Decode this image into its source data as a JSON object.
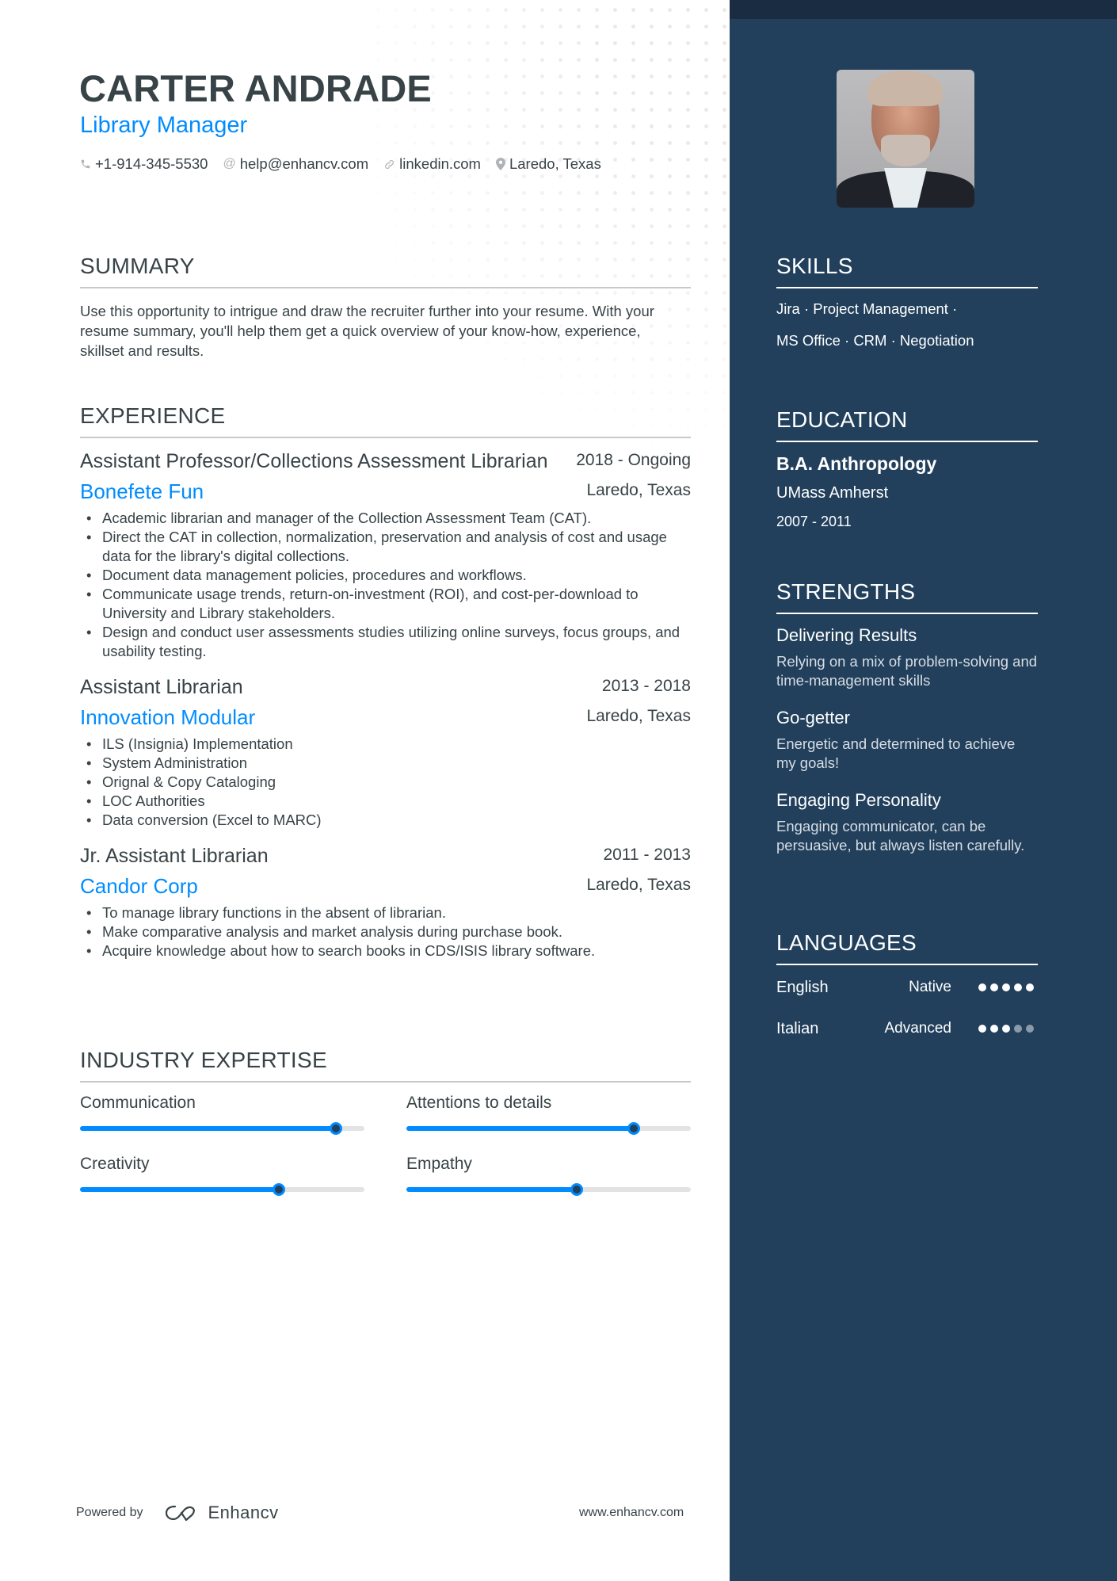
{
  "header": {
    "name": "CARTER ANDRADE",
    "role": "Library Manager",
    "contacts": [
      {
        "icon": "phone-icon",
        "text": "+1-914-345-5530"
      },
      {
        "icon": "at-icon",
        "text": "help@enhancv.com"
      },
      {
        "icon": "link-icon",
        "text": "linkedin.com"
      },
      {
        "icon": "location-pin-icon",
        "text": "Laredo, Texas"
      }
    ]
  },
  "summary": {
    "title": "SUMMARY",
    "text": "Use this opportunity to intrigue and draw the recruiter further into your resume. With your resume summary, you'll help them get a quick overview of your know-how, experience, skillset and results."
  },
  "experience": {
    "title": "EXPERIENCE",
    "jobs": [
      {
        "title": "Assistant Professor/Collections Assessment Librarian",
        "dates": "2018 - Ongoing",
        "company": "Bonefete Fun",
        "location": "Laredo, Texas",
        "bullets": [
          "Academic librarian and manager of the Collection Assessment Team (CAT).",
          "Direct the CAT in collection, normalization, preservation and analysis of cost and usage data for the library's digital collections.",
          "Document data management policies, procedures and workflows.",
          "Communicate usage trends, return-on-investment (ROI), and cost-per-download to University and Library stakeholders.",
          "Design and conduct user assessments studies utilizing online surveys, focus groups, and usability testing."
        ]
      },
      {
        "title": "Assistant Librarian",
        "dates": "2013 - 2018",
        "company": "Innovation Modular",
        "location": "Laredo, Texas",
        "bullets": [
          "ILS (Insignia) Implementation",
          "System Administration",
          "Orignal & Copy Cataloging",
          "LOC Authorities",
          "Data conversion (Excel to MARC)"
        ]
      },
      {
        "title": "Jr. Assistant Librarian",
        "dates": "2011 - 2013",
        "company": "Candor Corp",
        "location": "Laredo, Texas",
        "bullets": [
          "To manage  library functions in the absent of librarian.",
          "Make comparative analysis and market analysis during purchase book.",
          "Acquire knowledge about how to search books in CDS/ISIS library software."
        ]
      }
    ]
  },
  "industry_expertise": {
    "title": "INDUSTRY EXPERTISE",
    "items": [
      {
        "label": "Communication",
        "level_percent": 90
      },
      {
        "label": "Attentions to details",
        "level_percent": 80
      },
      {
        "label": "Creativity",
        "level_percent": 70
      },
      {
        "label": "Empathy",
        "level_percent": 60
      }
    ]
  },
  "footer": {
    "powered_by": "Powered by",
    "brand": "Enhancv",
    "website": "www.enhancv.com"
  },
  "sidebar": {
    "photo_alt": "Profile photo",
    "skills": {
      "title": "SKILLS",
      "lines": [
        "Jira · Project Management ·",
        "MS Office · CRM · Negotiation"
      ]
    },
    "education": {
      "title": "EDUCATION",
      "degree": "B.A. Anthropology",
      "school": "UMass Amherst",
      "years": "2007 - 2011"
    },
    "strengths": {
      "title": "STRENGTHS",
      "items": [
        {
          "title": "Delivering Results",
          "desc": "Relying on a mix of problem-solving and time-management skills"
        },
        {
          "title": "Go-getter",
          "desc": "Energetic and determined to achieve my goals!"
        },
        {
          "title": "Engaging Personality",
          "desc": "Engaging communicator, can be persuasive, but always listen carefully."
        }
      ]
    },
    "languages": {
      "title": "LANGUAGES",
      "items": [
        {
          "name": "English",
          "level": "Native",
          "dots_filled": 5,
          "dots_total": 5
        },
        {
          "name": "Italian",
          "level": "Advanced",
          "dots_filled": 3,
          "dots_total": 5
        }
      ]
    }
  },
  "colors": {
    "accent": "#008cff",
    "sidebar_bg": "#22405c",
    "sidebar_band": "#1a2c42",
    "text": "#384347"
  }
}
